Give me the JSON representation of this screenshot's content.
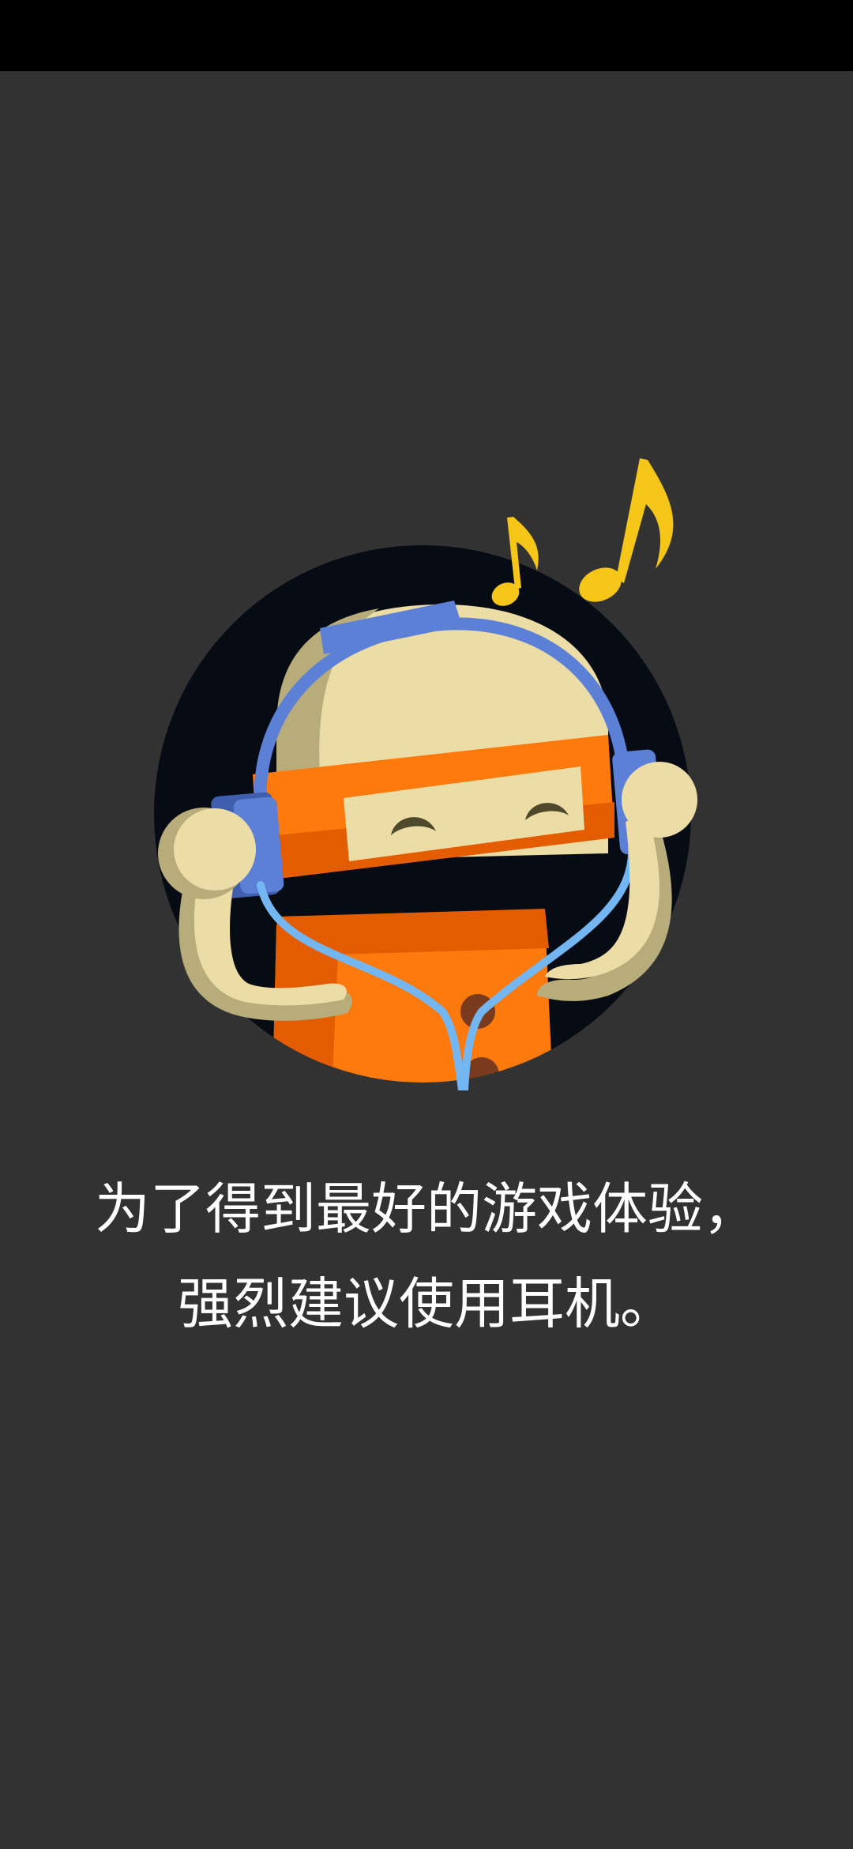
{
  "message": {
    "line1": "为了得到最好的游戏体验，",
    "line2": "强烈建议使用耳机。"
  },
  "colors": {
    "background": "#323232",
    "status_bar": "#000000",
    "circle": "#070b14",
    "robot_orange": "#ff7a0c",
    "robot_shadow": "#e35c00",
    "robot_skin": "#ecdca6",
    "headphone_blue": "#5b80d6",
    "cable_blue": "#74b6f2",
    "note_yellow": "#f5c518",
    "text": "#ffffff"
  },
  "icons": {
    "illustration": "robot-with-headphones-illustration",
    "notes": "music-notes-icon"
  }
}
